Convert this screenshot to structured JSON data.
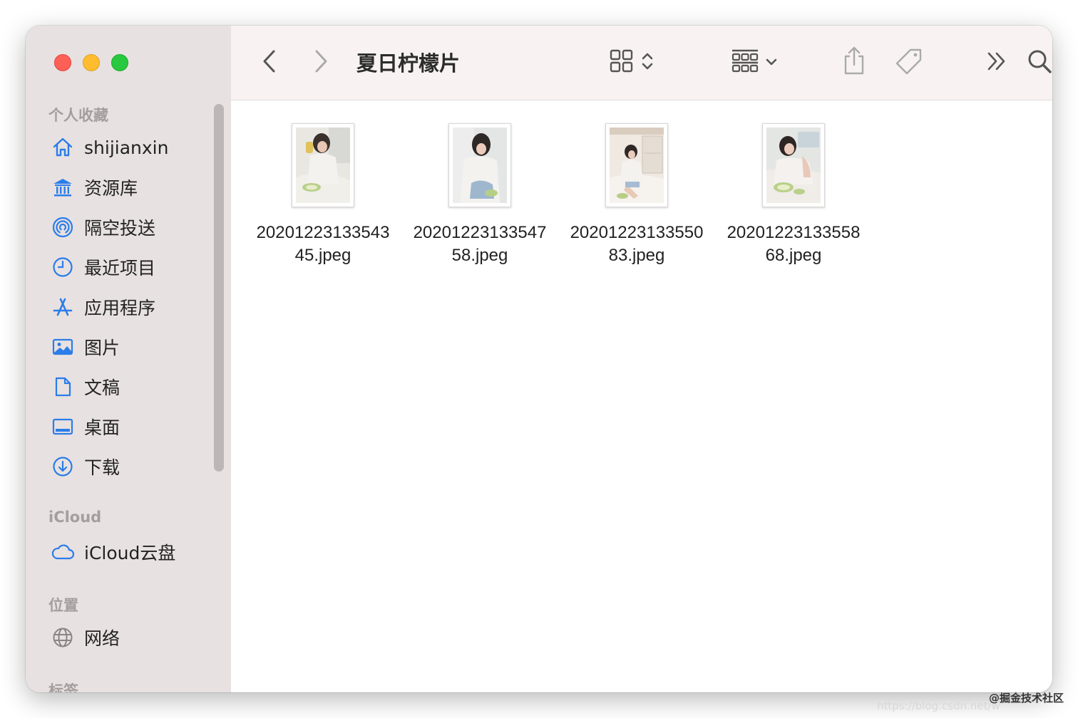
{
  "window": {
    "title": "夏日柠檬片"
  },
  "sidebar": {
    "sections": [
      {
        "heading": "个人收藏",
        "items": [
          {
            "label": "shijianxin",
            "icon": "house-icon"
          },
          {
            "label": "资源库",
            "icon": "library-icon"
          },
          {
            "label": "隔空投送",
            "icon": "airdrop-icon"
          },
          {
            "label": "最近项目",
            "icon": "clock-icon"
          },
          {
            "label": "应用程序",
            "icon": "applications-icon"
          },
          {
            "label": "图片",
            "icon": "photo-icon"
          },
          {
            "label": "文稿",
            "icon": "document-icon"
          },
          {
            "label": "桌面",
            "icon": "desktop-icon"
          },
          {
            "label": "下载",
            "icon": "download-icon"
          }
        ]
      },
      {
        "heading": "iCloud",
        "items": [
          {
            "label": "iCloud云盘",
            "icon": "cloud-icon"
          }
        ]
      },
      {
        "heading": "位置",
        "items": [
          {
            "label": "网络",
            "icon": "globe-icon"
          }
        ]
      },
      {
        "heading": "标签",
        "items": []
      }
    ]
  },
  "toolbar": {
    "icons": [
      "back-icon",
      "forward-icon",
      "grid-view-icon",
      "group-icon",
      "share-icon",
      "tag-icon",
      "more-icon",
      "search-icon"
    ]
  },
  "files": [
    {
      "line1": "20201223133543",
      "line2": "45.jpeg"
    },
    {
      "line1": "20201223133547",
      "line2": "58.jpeg"
    },
    {
      "line1": "20201223133550",
      "line2": "83.jpeg"
    },
    {
      "line1": "20201223133558",
      "line2": "68.jpeg"
    }
  ],
  "watermark": "@掘金技术社区",
  "watermark_url": "https://blog.csdn.net/w"
}
